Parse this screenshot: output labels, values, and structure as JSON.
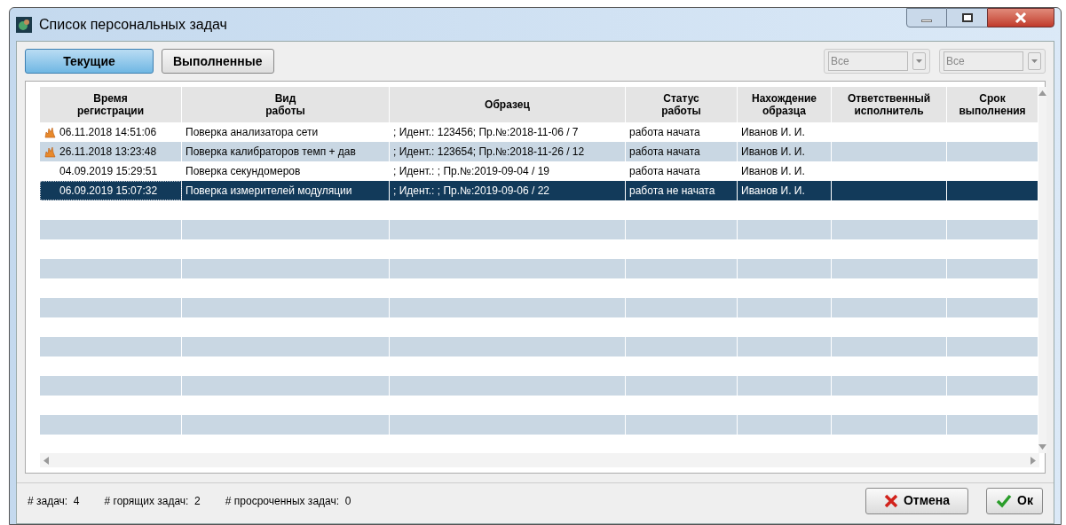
{
  "window": {
    "title": "Список персональных задач"
  },
  "tabs": [
    {
      "label": "Текущие",
      "selected": true
    },
    {
      "label": "Выполненные",
      "selected": false
    }
  ],
  "filters": [
    {
      "value": "Все",
      "disabled": true
    },
    {
      "value": "Все",
      "disabled": true
    }
  ],
  "table": {
    "columns": [
      "Время регистрации",
      "Вид работы",
      "Образец",
      "Статус работы",
      "Нахождение образца",
      "Ответственный исполнитель",
      "Срок выполнения"
    ],
    "rows": [
      {
        "hot": true,
        "selected": false,
        "cells": [
          "06.11.2018 14:51:06",
          "Поверка анализатора сети",
          "; Идент.: 123456; Пр.№:2018-11-06 / 7",
          "работа начата",
          "Иванов И. И.",
          "",
          ""
        ]
      },
      {
        "hot": true,
        "selected": false,
        "cells": [
          "26.11.2018 13:23:48",
          "Поверка калибраторов темп + дав",
          "; Идент.: 123654; Пр.№:2018-11-26 / 12",
          "работа начата",
          "Иванов И. И.",
          "",
          ""
        ]
      },
      {
        "hot": false,
        "selected": false,
        "cells": [
          "04.09.2019 15:29:51",
          "Поверка секундомеров",
          "; Идент.: ; Пр.№:2019-09-04 / 19",
          "работа начата",
          "Иванов И. И.",
          "",
          ""
        ]
      },
      {
        "hot": false,
        "selected": true,
        "cells": [
          "06.09.2019 15:07:32",
          "Поверка измерителей модуляции",
          "; Идент.: ; Пр.№:2019-09-06 / 22",
          "работа не начата",
          "Иванов И. И.",
          "",
          ""
        ]
      }
    ]
  },
  "status_bar": [
    "# задач:  4",
    "# горящих задач:  2",
    "# просроченных задач:  0"
  ],
  "buttons": [
    {
      "kind": "cancel",
      "label": "Отмена"
    },
    {
      "kind": "ok",
      "label": "Ок"
    }
  ]
}
